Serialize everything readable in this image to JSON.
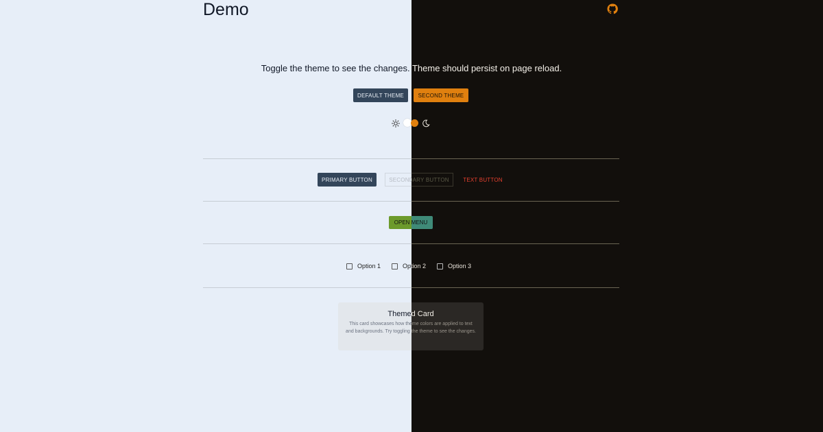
{
  "header": {
    "title": "Demo",
    "github_icon": "github-icon"
  },
  "intro": {
    "text": "Toggle the theme to see the changes. Theme should persist on page reload."
  },
  "theme_buttons": {
    "default_label": "DEFAULT THEME",
    "second_label": "SECOND THEME"
  },
  "mode_switch": {
    "left_icon": "sun-icon",
    "right_icon": "moon-icon"
  },
  "buttons": {
    "primary_label": "PRIMARY BUTTON",
    "secondary_label": "SECONDARY BUTTON",
    "text_label": "TEXT BUTTON"
  },
  "menu": {
    "open_label": "OPEN MENU"
  },
  "checkboxes": [
    {
      "label": "Option 1"
    },
    {
      "label": "Option 2"
    },
    {
      "label": "Option 3"
    }
  ],
  "card": {
    "title": "Themed Card",
    "body": "This card showcases how theme colors are applied to text and backgrounds. Try toggling the theme to see the changes."
  },
  "colors": {
    "light_bg": "#e7eef8",
    "dark_bg": "#120f0c",
    "primary": "#33455a",
    "accent_orange": "#e0800f",
    "text_button": "#e6402f"
  }
}
